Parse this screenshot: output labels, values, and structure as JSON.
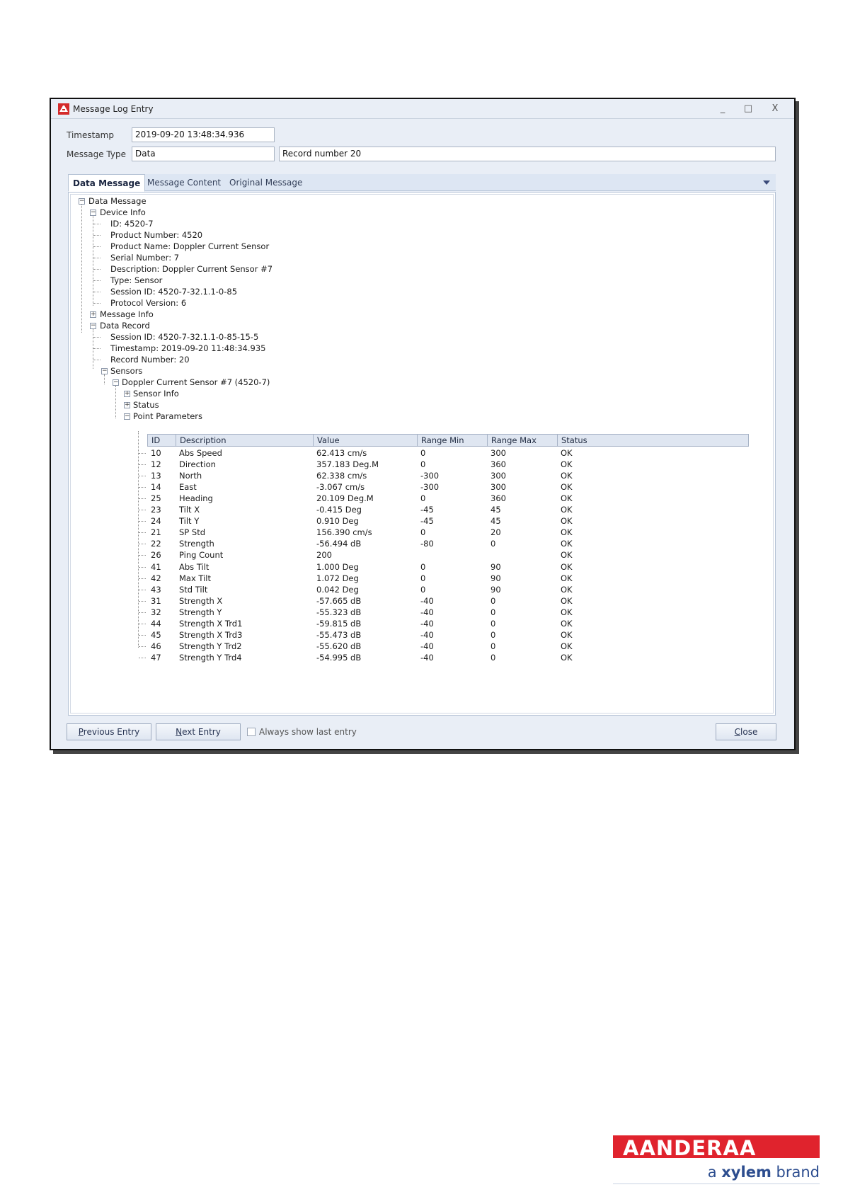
{
  "window": {
    "title": "Message Log Entry",
    "controls": {
      "minimize": "_",
      "maximize": "□",
      "close": "X"
    }
  },
  "form": {
    "timestamp_label": "Timestamp",
    "timestamp_value": "2019-09-20 13:48:34.936",
    "message_type_label": "Message Type",
    "message_type_value": "Data",
    "record_value": "Record number 20"
  },
  "tabs": [
    {
      "label": "Data Message",
      "active": true
    },
    {
      "label": "Message Content",
      "active": false
    },
    {
      "label": "Original Message",
      "active": false
    }
  ],
  "tree": {
    "root": "Data Message",
    "device_info": {
      "label": "Device Info",
      "items": [
        "ID: 4520-7",
        "Product Number: 4520",
        "Product Name: Doppler Current Sensor",
        "Serial Number: 7",
        "Description: Doppler Current Sensor #7",
        "Type: Sensor",
        "Session ID: 4520-7-32.1.1-0-85",
        "Protocol Version: 6"
      ]
    },
    "message_info": "Message Info",
    "data_record": {
      "label": "Data Record",
      "items": [
        "Session ID: 4520-7-32.1.1-0-85-15-5",
        "Timestamp: 2019-09-20 11:48:34.935",
        "Record Number: 20"
      ],
      "sensors": "Sensors",
      "sensor": "Doppler Current Sensor #7 (4520-7)",
      "sensor_info": "Sensor Info",
      "status": "Status",
      "point_parameters": "Point Parameters"
    }
  },
  "grid": {
    "columns": [
      "ID",
      "Description",
      "Value",
      "Range Min",
      "Range Max",
      "Status"
    ],
    "rows": [
      [
        "10",
        "Abs Speed",
        "62.413 cm/s",
        "0",
        "300",
        "OK"
      ],
      [
        "12",
        "Direction",
        "357.183 Deg.M",
        "0",
        "360",
        "OK"
      ],
      [
        "13",
        "North",
        "62.338 cm/s",
        "-300",
        "300",
        "OK"
      ],
      [
        "14",
        "East",
        "-3.067 cm/s",
        "-300",
        "300",
        "OK"
      ],
      [
        "25",
        "Heading",
        "20.109 Deg.M",
        "0",
        "360",
        "OK"
      ],
      [
        "23",
        "Tilt X",
        "-0.415 Deg",
        "-45",
        "45",
        "OK"
      ],
      [
        "24",
        "Tilt Y",
        "0.910 Deg",
        "-45",
        "45",
        "OK"
      ],
      [
        "21",
        "SP Std",
        "156.390 cm/s",
        "0",
        "20",
        "OK"
      ],
      [
        "22",
        "Strength",
        "-56.494 dB",
        "-80",
        "0",
        "OK"
      ],
      [
        "26",
        "Ping Count",
        "200",
        "",
        "",
        "OK"
      ],
      [
        "41",
        "Abs Tilt",
        "1.000 Deg",
        "0",
        "90",
        "OK"
      ],
      [
        "42",
        "Max Tilt",
        "1.072 Deg",
        "0",
        "90",
        "OK"
      ],
      [
        "43",
        "Std Tilt",
        "0.042 Deg",
        "0",
        "90",
        "OK"
      ],
      [
        "31",
        "Strength X",
        "-57.665 dB",
        "-40",
        "0",
        "OK"
      ],
      [
        "32",
        "Strength Y",
        "-55.323 dB",
        "-40",
        "0",
        "OK"
      ],
      [
        "44",
        "Strength X Trd1",
        "-59.815 dB",
        "-40",
        "0",
        "OK"
      ],
      [
        "45",
        "Strength X Trd3",
        "-55.473 dB",
        "-40",
        "0",
        "OK"
      ],
      [
        "46",
        "Strength Y Trd2",
        "-55.620 dB",
        "-40",
        "0",
        "OK"
      ],
      [
        "47",
        "Strength Y Trd4",
        "-54.995 dB",
        "-40",
        "0",
        "OK"
      ]
    ]
  },
  "footer": {
    "previous_label": "Previous Entry",
    "next_label": "Next Entry",
    "always_show_label": "Always show last entry",
    "always_show_checked": false,
    "close_label": "Close"
  },
  "logo": {
    "wordmark": "AANDERAA",
    "tagline_prefix": "a",
    "tagline_brand": "xylem",
    "tagline_suffix": "brand",
    "brand_red": "#e0232d",
    "brand_blue": "#2c4d8f"
  }
}
